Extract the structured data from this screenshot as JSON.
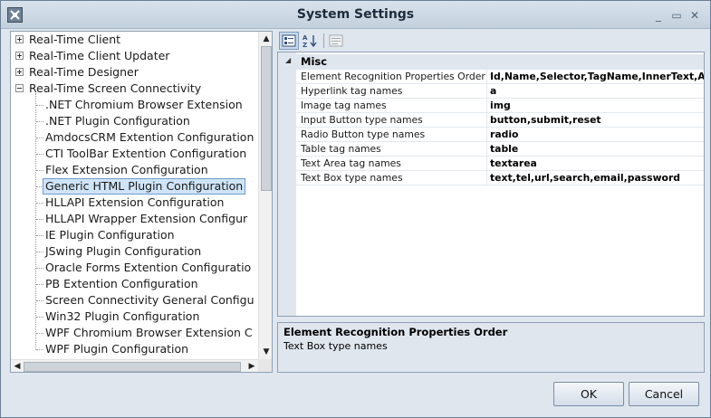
{
  "window": {
    "title": "System Settings",
    "minimize": "_",
    "maximize": "▭",
    "close": "✕"
  },
  "tree": {
    "roots": [
      {
        "label": "Real-Time Client",
        "expanded": false
      },
      {
        "label": "Real-Time Client Updater",
        "expanded": false
      },
      {
        "label": "Real-Time Designer",
        "expanded": false
      },
      {
        "label": "Real-Time Screen Connectivity",
        "expanded": true
      }
    ],
    "children": [
      ".NET Chromium Browser Extension",
      ".NET Plugin Configuration",
      "AmdocsCRM Extention Configuration",
      "CTI ToolBar Extention Configuration",
      "Flex Extension Configuration",
      "Generic HTML Plugin Configuration",
      "HLLAPI Extension Configuration",
      "HLLAPI Wrapper Extension Configur",
      "IE Plugin Configuration",
      "JSwing Plugin Configuration",
      "Oracle Forms Extention Configuratio",
      "PB Extention Configuration",
      "Screen Connectivity General Configu",
      "Win32 Plugin Configuration",
      "WPF Chromium Browser Extension C",
      "WPF Plugin Configuration"
    ],
    "selected": "Generic HTML Plugin Configuration"
  },
  "toolbar": {
    "categorized": "categorized-icon",
    "alphabetical": "sort-az-icon",
    "property_pages": "property-pages-icon"
  },
  "grid": {
    "category": "Misc",
    "properties": [
      {
        "name": "Element Recognition Properties Order",
        "value": "Id,Name,Selector,TagName,InnerText,Attri"
      },
      {
        "name": "Hyperlink tag names",
        "value": "a"
      },
      {
        "name": "Image tag names",
        "value": "img"
      },
      {
        "name": "Input Button type names",
        "value": "button,submit,reset"
      },
      {
        "name": "Radio Button type names",
        "value": "radio"
      },
      {
        "name": "Table tag names",
        "value": "table"
      },
      {
        "name": "Text Area tag names",
        "value": "textarea"
      },
      {
        "name": "Text Box type names",
        "value": "text,tel,url,search,email,password"
      }
    ]
  },
  "description": {
    "title": "Element Recognition Properties Order",
    "text": "Text Box type names"
  },
  "buttons": {
    "ok": "OK",
    "cancel": "Cancel"
  },
  "colors": {
    "selection_bg": "#cfe4f7",
    "selection_border": "#6d9ccf",
    "chrome": "#dfe6ee"
  }
}
